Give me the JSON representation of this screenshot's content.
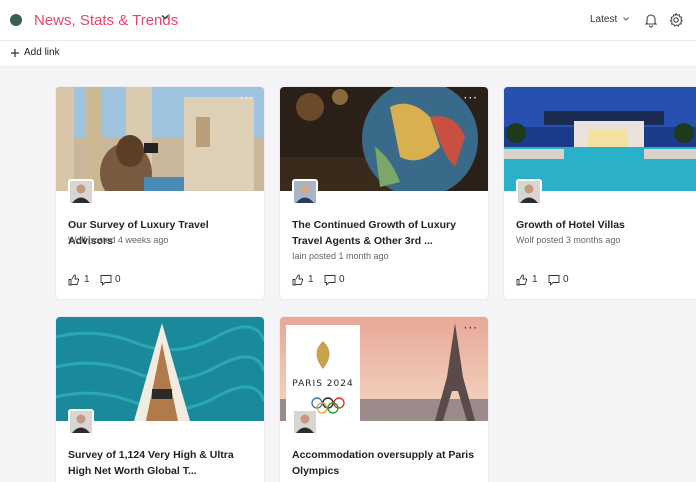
{
  "header": {
    "title": "News, Stats & Trends",
    "sort_label": "Latest",
    "icons": [
      "app-dot",
      "chevron-down-icon",
      "bell-icon",
      "gear-icon"
    ]
  },
  "toolbar": {
    "add_link_label": "Add link"
  },
  "colors": {
    "accent": "#e8456a",
    "app_dot": "#3b5d5a",
    "background": "#f4f4f6"
  },
  "cards": [
    {
      "title": "Our Survey of Luxury Travel Advisors",
      "meta": "Wolf posted 4 weeks ago",
      "likes": "1",
      "comments": "0"
    },
    {
      "title": "The Continued Growth of Luxury Travel Agents & Other 3rd ...",
      "meta": "Iain posted 1 month ago",
      "likes": "1",
      "comments": "0"
    },
    {
      "title": "Growth of Hotel Villas",
      "meta": "Wolf posted 3 months ago",
      "likes": "1",
      "comments": "0"
    },
    {
      "title": "Survey of 1,124 Very High & Ultra High Net Worth Global T...",
      "meta": "",
      "likes": "",
      "comments": ""
    },
    {
      "title": "Accommodation oversupply at Paris Olympics",
      "meta": "",
      "likes": "",
      "comments": "",
      "logo_text": "PARIS 2024"
    }
  ]
}
